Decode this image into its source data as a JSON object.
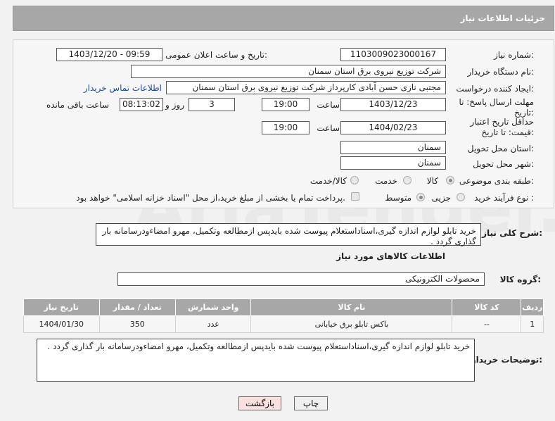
{
  "header": {
    "title": "جزئیات اطلاعات نیاز"
  },
  "fields": {
    "need_number_label": "شماره نیاز:",
    "need_number": "1103009023000167",
    "announce_label": "تاریخ و ساعت اعلان عمومی:",
    "announce_value": "1403/12/20 - 09:59",
    "buyer_label": "نام دستگاه خریدار:",
    "buyer_value": "شرکت توزیع نیروی برق استان سمنان",
    "creator_label": "ایجاد کننده درخواست:",
    "creator_value": "مجتبی نازی حسن آبادی کارپرداز شرکت توزیع نیروی برق استان سمنان",
    "contact_link": "اطلاعات تماس خریدار",
    "deadline_label": "مهلت ارسال پاسخ: تا تاریخ:",
    "deadline_date": "1403/12/23",
    "time_label": "ساعت",
    "deadline_time": "19:00",
    "days_value": "3",
    "days_label": "روز و",
    "remaining_value": "08:13:02",
    "remaining_label": "ساعت باقی مانده",
    "validity_label": "حداقل تاریخ اعتبار قیمت: تا تاریخ:",
    "validity_date": "1404/02/23",
    "validity_time": "19:00",
    "province_label": "استان محل تحویل:",
    "province_value": "سمنان",
    "city_label": "شهر محل تحویل:",
    "city_value": "سمنان",
    "category_label": "طبقه بندی موضوعی:",
    "category_options": [
      "کالا",
      "خدمت",
      "کالا/خدمت"
    ],
    "category_selected": "کالا",
    "process_label": "نوع فرآیند خرید :",
    "process_options": [
      "جزیی",
      "متوسط"
    ],
    "payment_note": "پرداخت تمام یا بخشی از مبلغ خرید،از محل \"اسناد خزانه اسلامی\" خواهد بود."
  },
  "summary": {
    "label": "شرح کلی نیاز:",
    "text": "خرید تابلو لوازم اندازه گیری،اسناداستعلام پیوست شده بایدپس ازمطالعه وتکمیل، مهرو امضاءودرسامانه بار گذاری گردد ."
  },
  "goods": {
    "section_title": "اطلاعات کالاهای مورد نیاز",
    "group_label": "گروه کالا:",
    "group_value": "محصولات الکترونیکی",
    "columns": [
      "ردیف",
      "کد کالا",
      "نام کالا",
      "واحد شمارش",
      "تعداد / مقدار",
      "تاریخ نیاز"
    ],
    "rows": [
      [
        "1",
        "--",
        "باکس تابلو برق خیابانی",
        "عدد",
        "350",
        "1404/01/30"
      ]
    ]
  },
  "buyer_notes": {
    "label": "توضیحات خریدار:",
    "text": "خرید تابلو لوازم اندازه گیری،اسناداستعلام پیوست شده بایدپس ازمطالعه وتکمیل، مهرو امضاءودرسامانه بار گذاری گردد ."
  },
  "buttons": {
    "print": "چاپ",
    "back": "بازگشت"
  },
  "watermark": "AriaTender.neT"
}
